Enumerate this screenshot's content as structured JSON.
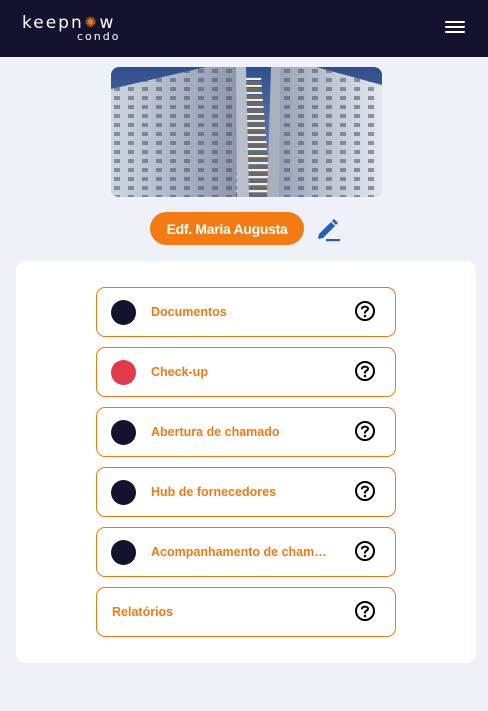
{
  "header": {
    "logo_main_left": "keepn",
    "logo_main_right": "w",
    "logo_sub": "condo"
  },
  "building": {
    "name": "Edf. Maria Augusta"
  },
  "colors": {
    "header_bg": "#13132f",
    "accent": "#f47a12",
    "dot_dark": "#13132f",
    "dot_red": "#e23a4b"
  },
  "menu": {
    "items": [
      {
        "label": "Documentos",
        "dot": "dark"
      },
      {
        "label": "Check-up",
        "dot": "red"
      },
      {
        "label": "Abertura de chamado",
        "dot": "dark"
      },
      {
        "label": "Hub de fornecedores",
        "dot": "dark"
      },
      {
        "label": "Acompanhamento de chamados",
        "dot": "dark"
      },
      {
        "label": "Relatórios",
        "dot": "none"
      }
    ]
  },
  "icons": {
    "menu": "hamburger-icon",
    "edit": "pencil-icon",
    "help": "question-circle-icon"
  }
}
